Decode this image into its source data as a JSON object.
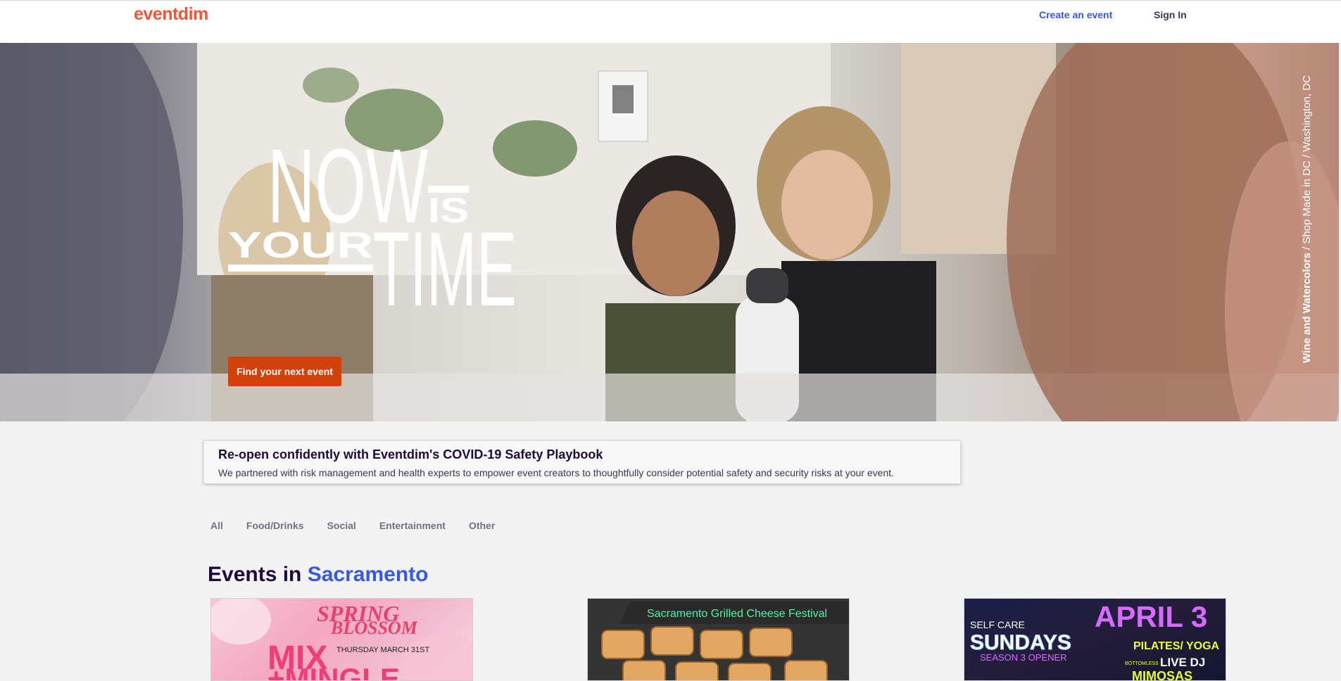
{
  "header": {
    "logo": "eventdim",
    "create_event": "Create an event",
    "sign_in": "Sign In"
  },
  "hero": {
    "title_words": [
      "NOW",
      "IS",
      "YOUR",
      "TIME"
    ],
    "cta_label": "Find your next event",
    "credit_bold": "Wine and Watercolors",
    "credit_rest": " / Shop Made in DC / Washington, DC"
  },
  "banner": {
    "title": "Re-open confidently with Eventdim's COVID-19 Safety Playbook",
    "text": "We partnered with risk management and health experts to empower event creators to thoughtfully consider potential safety and security risks at your event."
  },
  "tabs": [
    "All",
    "Food/Drinks",
    "Social",
    "Entertainment",
    "Other"
  ],
  "events_section": {
    "prefix": "Events in ",
    "city": "Sacramento"
  },
  "cards": [
    {
      "line1": "SPRING",
      "line2": "BLOSSOM",
      "line3": "MIX",
      "line4": "THURSDAY MARCH 31ST",
      "line5": "+MINGLE"
    },
    {
      "line1": "Sacramento Grilled Cheese Festival"
    },
    {
      "line1": "APRIL 3",
      "line2": "SELF CARE",
      "line3": "SUNDAYS",
      "line4": "SEASON 3 OPENER",
      "line5": "PILATES/ YOGA",
      "line6": "BOTTOMLESS",
      "line7": "LIVE DJ",
      "line8": "MIMOSAS"
    }
  ]
}
